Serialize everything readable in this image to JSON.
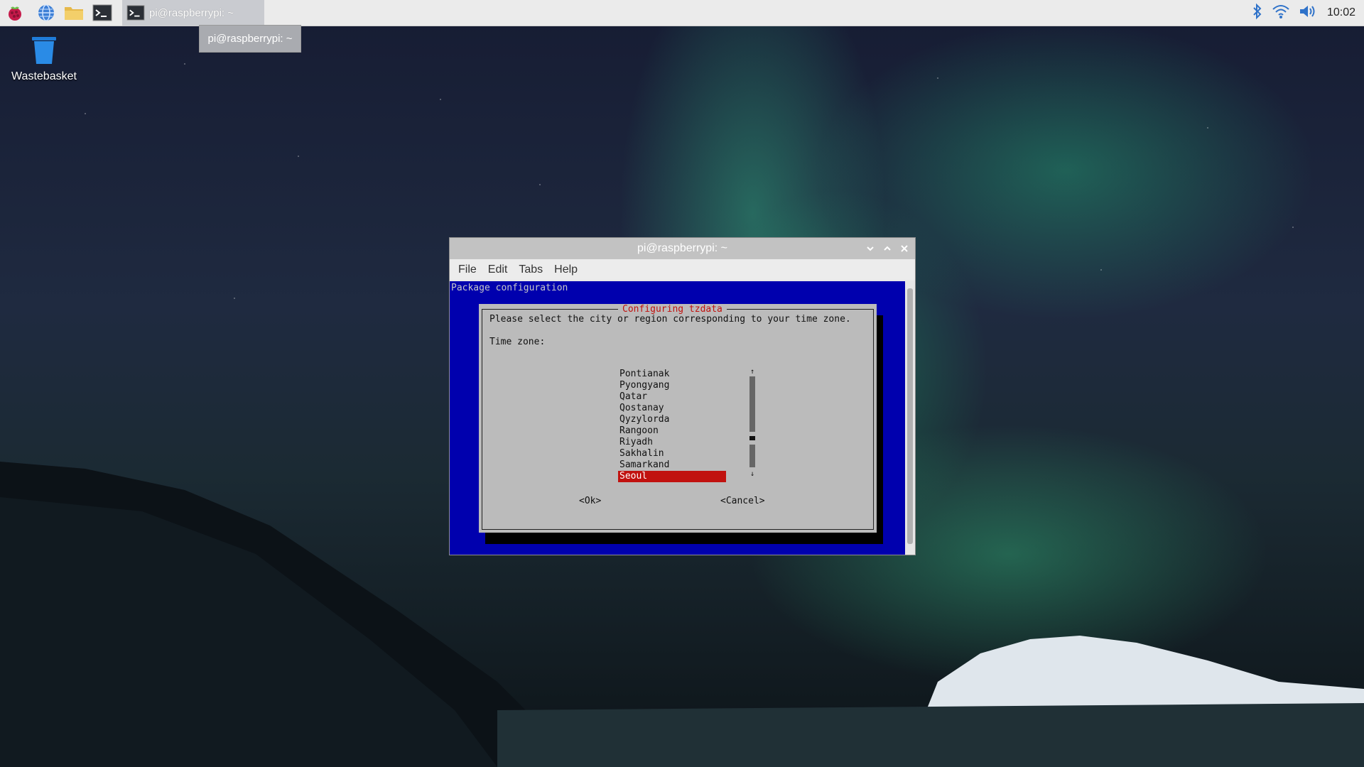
{
  "taskbar": {
    "apps": [
      "raspberry-menu-icon",
      "web-browser-icon",
      "file-manager-icon",
      "terminal-icon"
    ],
    "active_task": "pi@raspberrypi: ~",
    "tooltip": "pi@raspberrypi: ~",
    "tray": {
      "clock": "10:02"
    }
  },
  "desktop": {
    "wastebasket_label": "Wastebasket"
  },
  "window": {
    "title": "pi@raspberrypi: ~",
    "menu": [
      "File",
      "Edit",
      "Tabs",
      "Help"
    ]
  },
  "terminal": {
    "header": "Package configuration",
    "dialog": {
      "title": "Configuring tzdata",
      "prompt": "Please select the city or region corresponding to your time zone.",
      "label": "Time zone:",
      "items": [
        "Pontianak",
        "Pyongyang",
        "Qatar",
        "Qostanay",
        "Qyzylorda",
        "Rangoon",
        "Riyadh",
        "Sakhalin",
        "Samarkand",
        "Seoul"
      ],
      "selected": "Seoul",
      "ok_button": "<Ok>",
      "cancel_button": "<Cancel>"
    }
  },
  "colors": {
    "terminal_bg": "#0000ae",
    "dialog_bg": "#bbbbbb",
    "selection": "#c1120f"
  }
}
